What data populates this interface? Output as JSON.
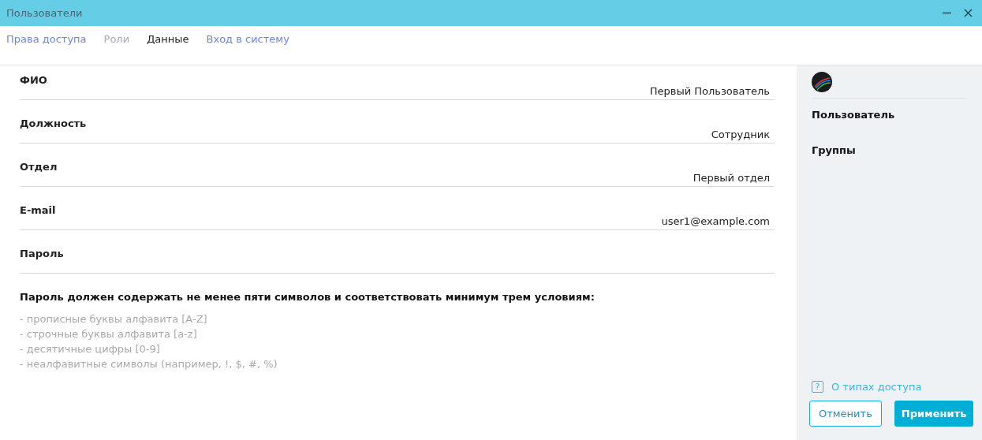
{
  "window": {
    "title": "Пользователи"
  },
  "tabs": [
    {
      "label": "Права доступа",
      "selected": false,
      "disabled": false
    },
    {
      "label": "Роли",
      "selected": false,
      "disabled": true
    },
    {
      "label": "Данные",
      "selected": true,
      "disabled": false
    },
    {
      "label": "Вход в систему",
      "selected": false,
      "disabled": false
    }
  ],
  "fields": [
    {
      "label": "ФИО",
      "value": "Первый Пользователь"
    },
    {
      "label": "Должность",
      "value": "Сотрудник"
    },
    {
      "label": "Отдел",
      "value": "Первый отдел"
    },
    {
      "label": "E-mail",
      "value": "user1@example.com"
    },
    {
      "label": "Пароль"
    }
  ],
  "password_rules": {
    "title": "Пароль должен содержать не менее пяти символов и соответствовать минимум трем условиям:",
    "items": [
      "- прописные буквы алфавита [A-Z]",
      "- строчные буквы алфавита [a-z]",
      "- десятичные цифры [0-9]",
      "- неалфавитные символы (например, !, $, #, %)"
    ]
  },
  "sidebar": {
    "items": [
      "Пользователь",
      "Группы"
    ],
    "help_icon": "?",
    "help_link": "О типах доступа",
    "buttons": {
      "cancel": "Отменить",
      "apply": "Применить"
    }
  }
}
